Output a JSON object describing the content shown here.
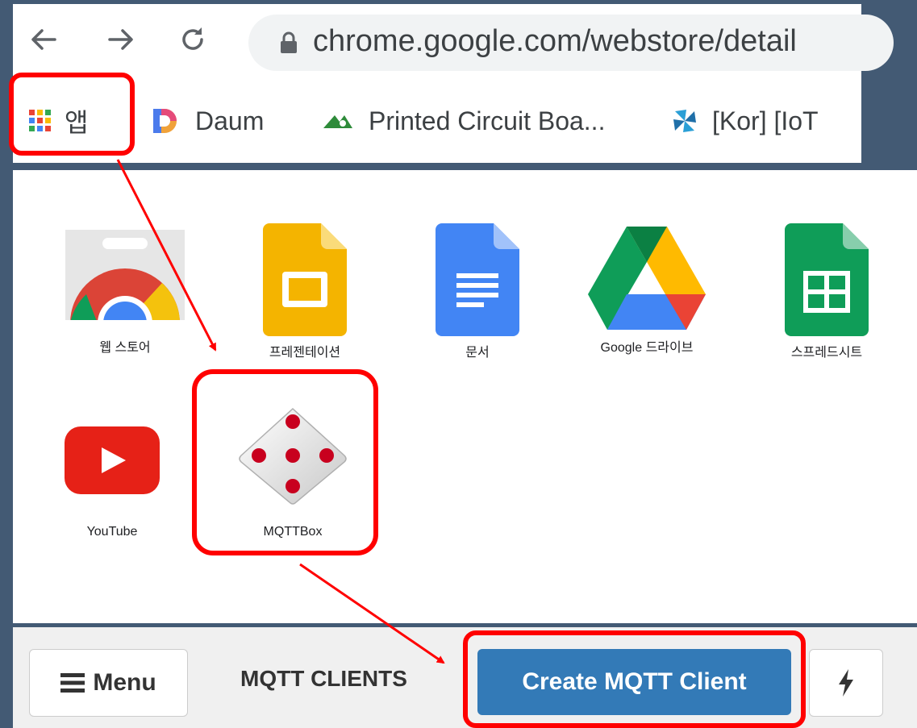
{
  "browser": {
    "url": "chrome.google.com/webstore/detail",
    "bookmarks": [
      {
        "label": "앱",
        "icon": "apps-grid-icon"
      },
      {
        "label": "Daum",
        "icon": "daum-logo-icon"
      },
      {
        "label": "Printed Circuit Boa...",
        "icon": "pcb-logo-icon"
      },
      {
        "label": "[Kor] [IoT",
        "icon": "pinwheel-icon"
      }
    ]
  },
  "apps": [
    {
      "label": "웹 스토어",
      "icon": "chrome-web-store-icon"
    },
    {
      "label": "프레젠테이션",
      "icon": "google-slides-icon"
    },
    {
      "label": "문서",
      "icon": "google-docs-icon"
    },
    {
      "label": "Google 드라이브",
      "icon": "google-drive-icon"
    },
    {
      "label": "스프레드시트",
      "icon": "google-sheets-icon"
    },
    {
      "label": "YouTube",
      "icon": "youtube-icon"
    },
    {
      "label": "MQTTBox",
      "icon": "mqttbox-dice-icon"
    }
  ],
  "mqtt": {
    "menu_label": "Menu",
    "section_title": "MQTT CLIENTS",
    "create_label": "Create MQTT Client"
  },
  "colors": {
    "highlight": "#ff0000",
    "primary_button": "#337ab7",
    "background": "#435a74"
  }
}
